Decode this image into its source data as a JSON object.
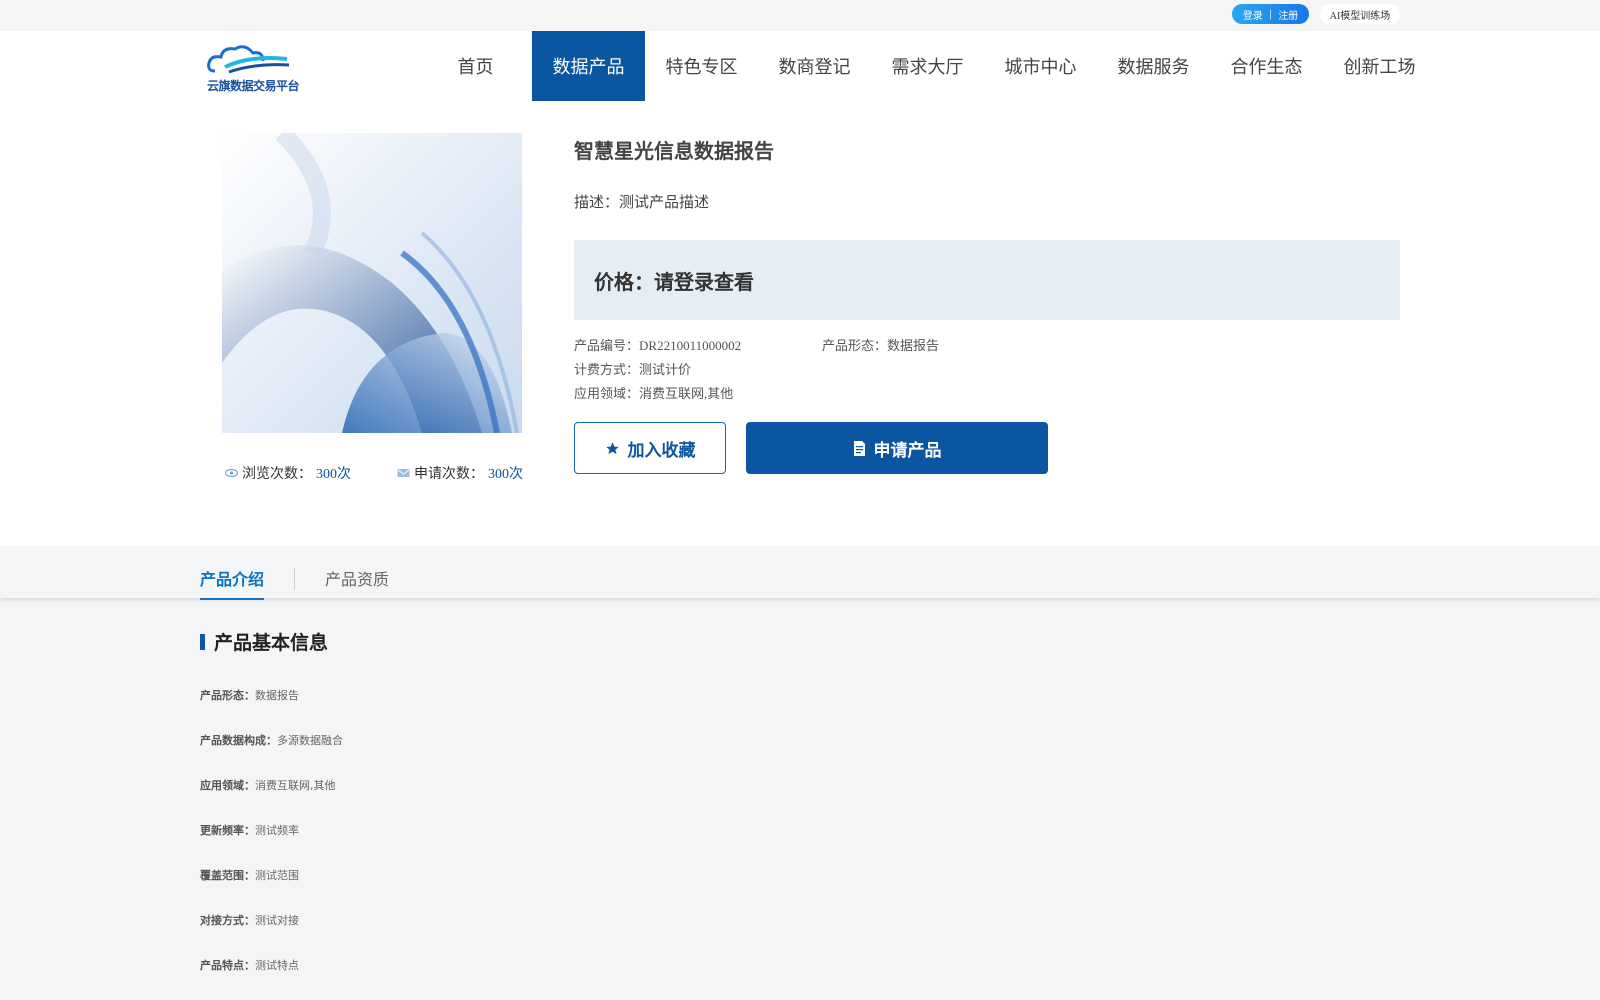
{
  "topbar": {
    "login": "登录",
    "separator": "|",
    "register": "注册",
    "ai_link": "AI模型训练场"
  },
  "header": {
    "logo_text": "云旗数据交易平台",
    "nav": [
      {
        "label": "首页",
        "active": false
      },
      {
        "label": "数据产品",
        "active": true
      },
      {
        "label": "特色专区",
        "active": false
      },
      {
        "label": "数商登记",
        "active": false
      },
      {
        "label": "需求大厅",
        "active": false
      },
      {
        "label": "城市中心",
        "active": false
      },
      {
        "label": "数据服务",
        "active": false
      },
      {
        "label": "合作生态",
        "active": false
      },
      {
        "label": "创新工场",
        "active": false
      }
    ]
  },
  "product": {
    "title": "智慧星光信息数据报告",
    "description": "描述：测试产品描述",
    "price": "价格：请登录查看",
    "code_label": "产品编号：",
    "code": "DR2210011000002",
    "form_label": "产品形态：",
    "form": "数据报告",
    "billing_label": "计费方式：",
    "billing": "测试计价",
    "domain_label": "应用领域：",
    "domain": "消费互联网,其他",
    "favorite_label": "加入收藏",
    "apply_label": "申请产品",
    "views_label": "浏览次数：",
    "views": "300次",
    "applies_label": "申请次数：",
    "applies": "300次"
  },
  "tabs": [
    {
      "label": "产品介绍",
      "active": true
    },
    {
      "label": "产品资质",
      "active": false
    }
  ],
  "basic_info": {
    "title": "产品基本信息",
    "rows": [
      {
        "label": "产品形态：",
        "value": "数据报告"
      },
      {
        "label": "产品数据构成：",
        "value": "多源数据融合"
      },
      {
        "label": "应用领域：",
        "value": "消费互联网,其他"
      },
      {
        "label": "更新频率：",
        "value": "测试频率"
      },
      {
        "label": "覆盖范围：",
        "value": "测试范围"
      },
      {
        "label": "对接方式：",
        "value": "测试对接"
      },
      {
        "label": "产品特点：",
        "value": "测试特点"
      }
    ]
  },
  "colors": {
    "primary": "#0a56a0",
    "tab_active": "#0a73c4",
    "price_bg": "#e4eef4"
  }
}
